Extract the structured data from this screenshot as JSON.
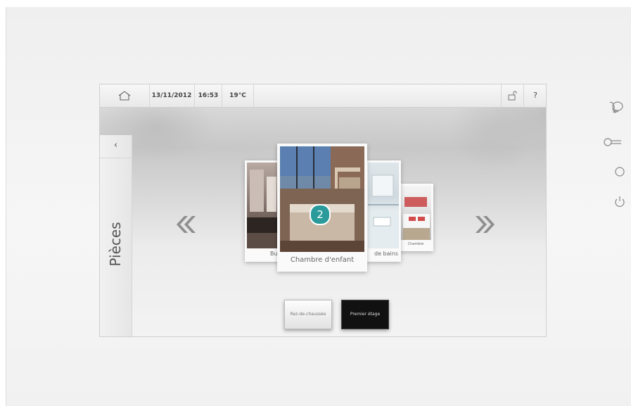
{
  "status_bar": {
    "date": "13/11/2012",
    "time": "16:53",
    "temperature": "19°C",
    "help": "?"
  },
  "side_panel": {
    "back": "‹",
    "title": "Pièces"
  },
  "carousel": {
    "prev_icon": "double-chevron-left",
    "next_icon": "double-chevron-right",
    "rooms": [
      {
        "label": "Bu"
      },
      {
        "label": "Chambre d'enfant",
        "badge": "2"
      },
      {
        "label": "de bains"
      },
      {
        "label": "Chambre"
      }
    ]
  },
  "floors": {
    "ground": "Rez-de-chaussée",
    "first": "Premier étage"
  },
  "side_buttons": [
    "voice-call-icon",
    "key-icon",
    "circle-icon",
    "power-icon"
  ],
  "colors": {
    "badge": "#2a9a9a",
    "selected_floor": "#111111"
  }
}
